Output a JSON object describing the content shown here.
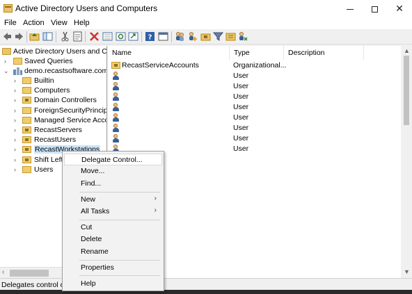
{
  "window": {
    "title": "Active Directory Users and Computers",
    "minimize_icon": "minimize-icon",
    "maximize_icon": "maximize-icon",
    "close_glyph": "✕"
  },
  "menubar": {
    "items": [
      "File",
      "Action",
      "View",
      "Help"
    ]
  },
  "toolbar": {
    "icons": [
      "back-arrow-icon",
      "forward-arrow-icon",
      "up-folder-icon",
      "show-tree-icon",
      "cut-icon",
      "properties-icon",
      "delete-icon",
      "export-list-icon",
      "refresh-icon",
      "export-icon",
      "help-icon",
      "console-icon",
      "users-icon",
      "add-user-icon",
      "new-ou-icon",
      "filter-icon",
      "add-to-group-icon",
      "delegate-icon"
    ]
  },
  "tree": {
    "root": "Active Directory Users and Com",
    "saved_queries": "Saved Queries",
    "domain": "demo.recastsoftware.com",
    "children": [
      {
        "label": "Builtin",
        "ou": false
      },
      {
        "label": "Computers",
        "ou": false
      },
      {
        "label": "Domain Controllers",
        "ou": true
      },
      {
        "label": "ForeignSecurityPrincipals",
        "ou": false
      },
      {
        "label": "Managed Service Accoun",
        "ou": false
      },
      {
        "label": "RecastServers",
        "ou": true
      },
      {
        "label": "RecastUsers",
        "ou": true
      },
      {
        "label": "RecastWorkstations",
        "ou": true,
        "selected": true
      },
      {
        "label": "Shift Left",
        "ou": true
      },
      {
        "label": "Users",
        "ou": false
      }
    ]
  },
  "list": {
    "columns": {
      "name": "Name",
      "type": "Type",
      "description": "Description"
    },
    "rows": [
      {
        "name": "RecastServiceAccounts",
        "type": "Organizational...",
        "icon": "ou-folder-icon"
      },
      {
        "name": "",
        "type": "User",
        "icon": "user-icon"
      },
      {
        "name": "",
        "type": "User",
        "icon": "user-icon"
      },
      {
        "name": "",
        "type": "User",
        "icon": "user-icon"
      },
      {
        "name": "",
        "type": "User",
        "icon": "user-icon"
      },
      {
        "name": "",
        "type": "User",
        "icon": "user-icon"
      },
      {
        "name": "",
        "type": "User",
        "icon": "user-icon"
      },
      {
        "name": "",
        "type": "User",
        "icon": "user-icon"
      },
      {
        "name": "",
        "type": "User",
        "icon": "user-icon"
      }
    ]
  },
  "context_menu": {
    "delegate_control": "Delegate Control...",
    "move": "Move...",
    "find": "Find...",
    "new": "New",
    "all_tasks": "All Tasks",
    "cut": "Cut",
    "delete": "Delete",
    "rename": "Rename",
    "properties": "Properties",
    "help": "Help",
    "submenu_glyph": "›"
  },
  "status": {
    "text": "Delegates control of o"
  },
  "colors": {
    "selection": "#cce4f7",
    "folder": "#f1cc6b",
    "user_body": "#3a5f94"
  }
}
